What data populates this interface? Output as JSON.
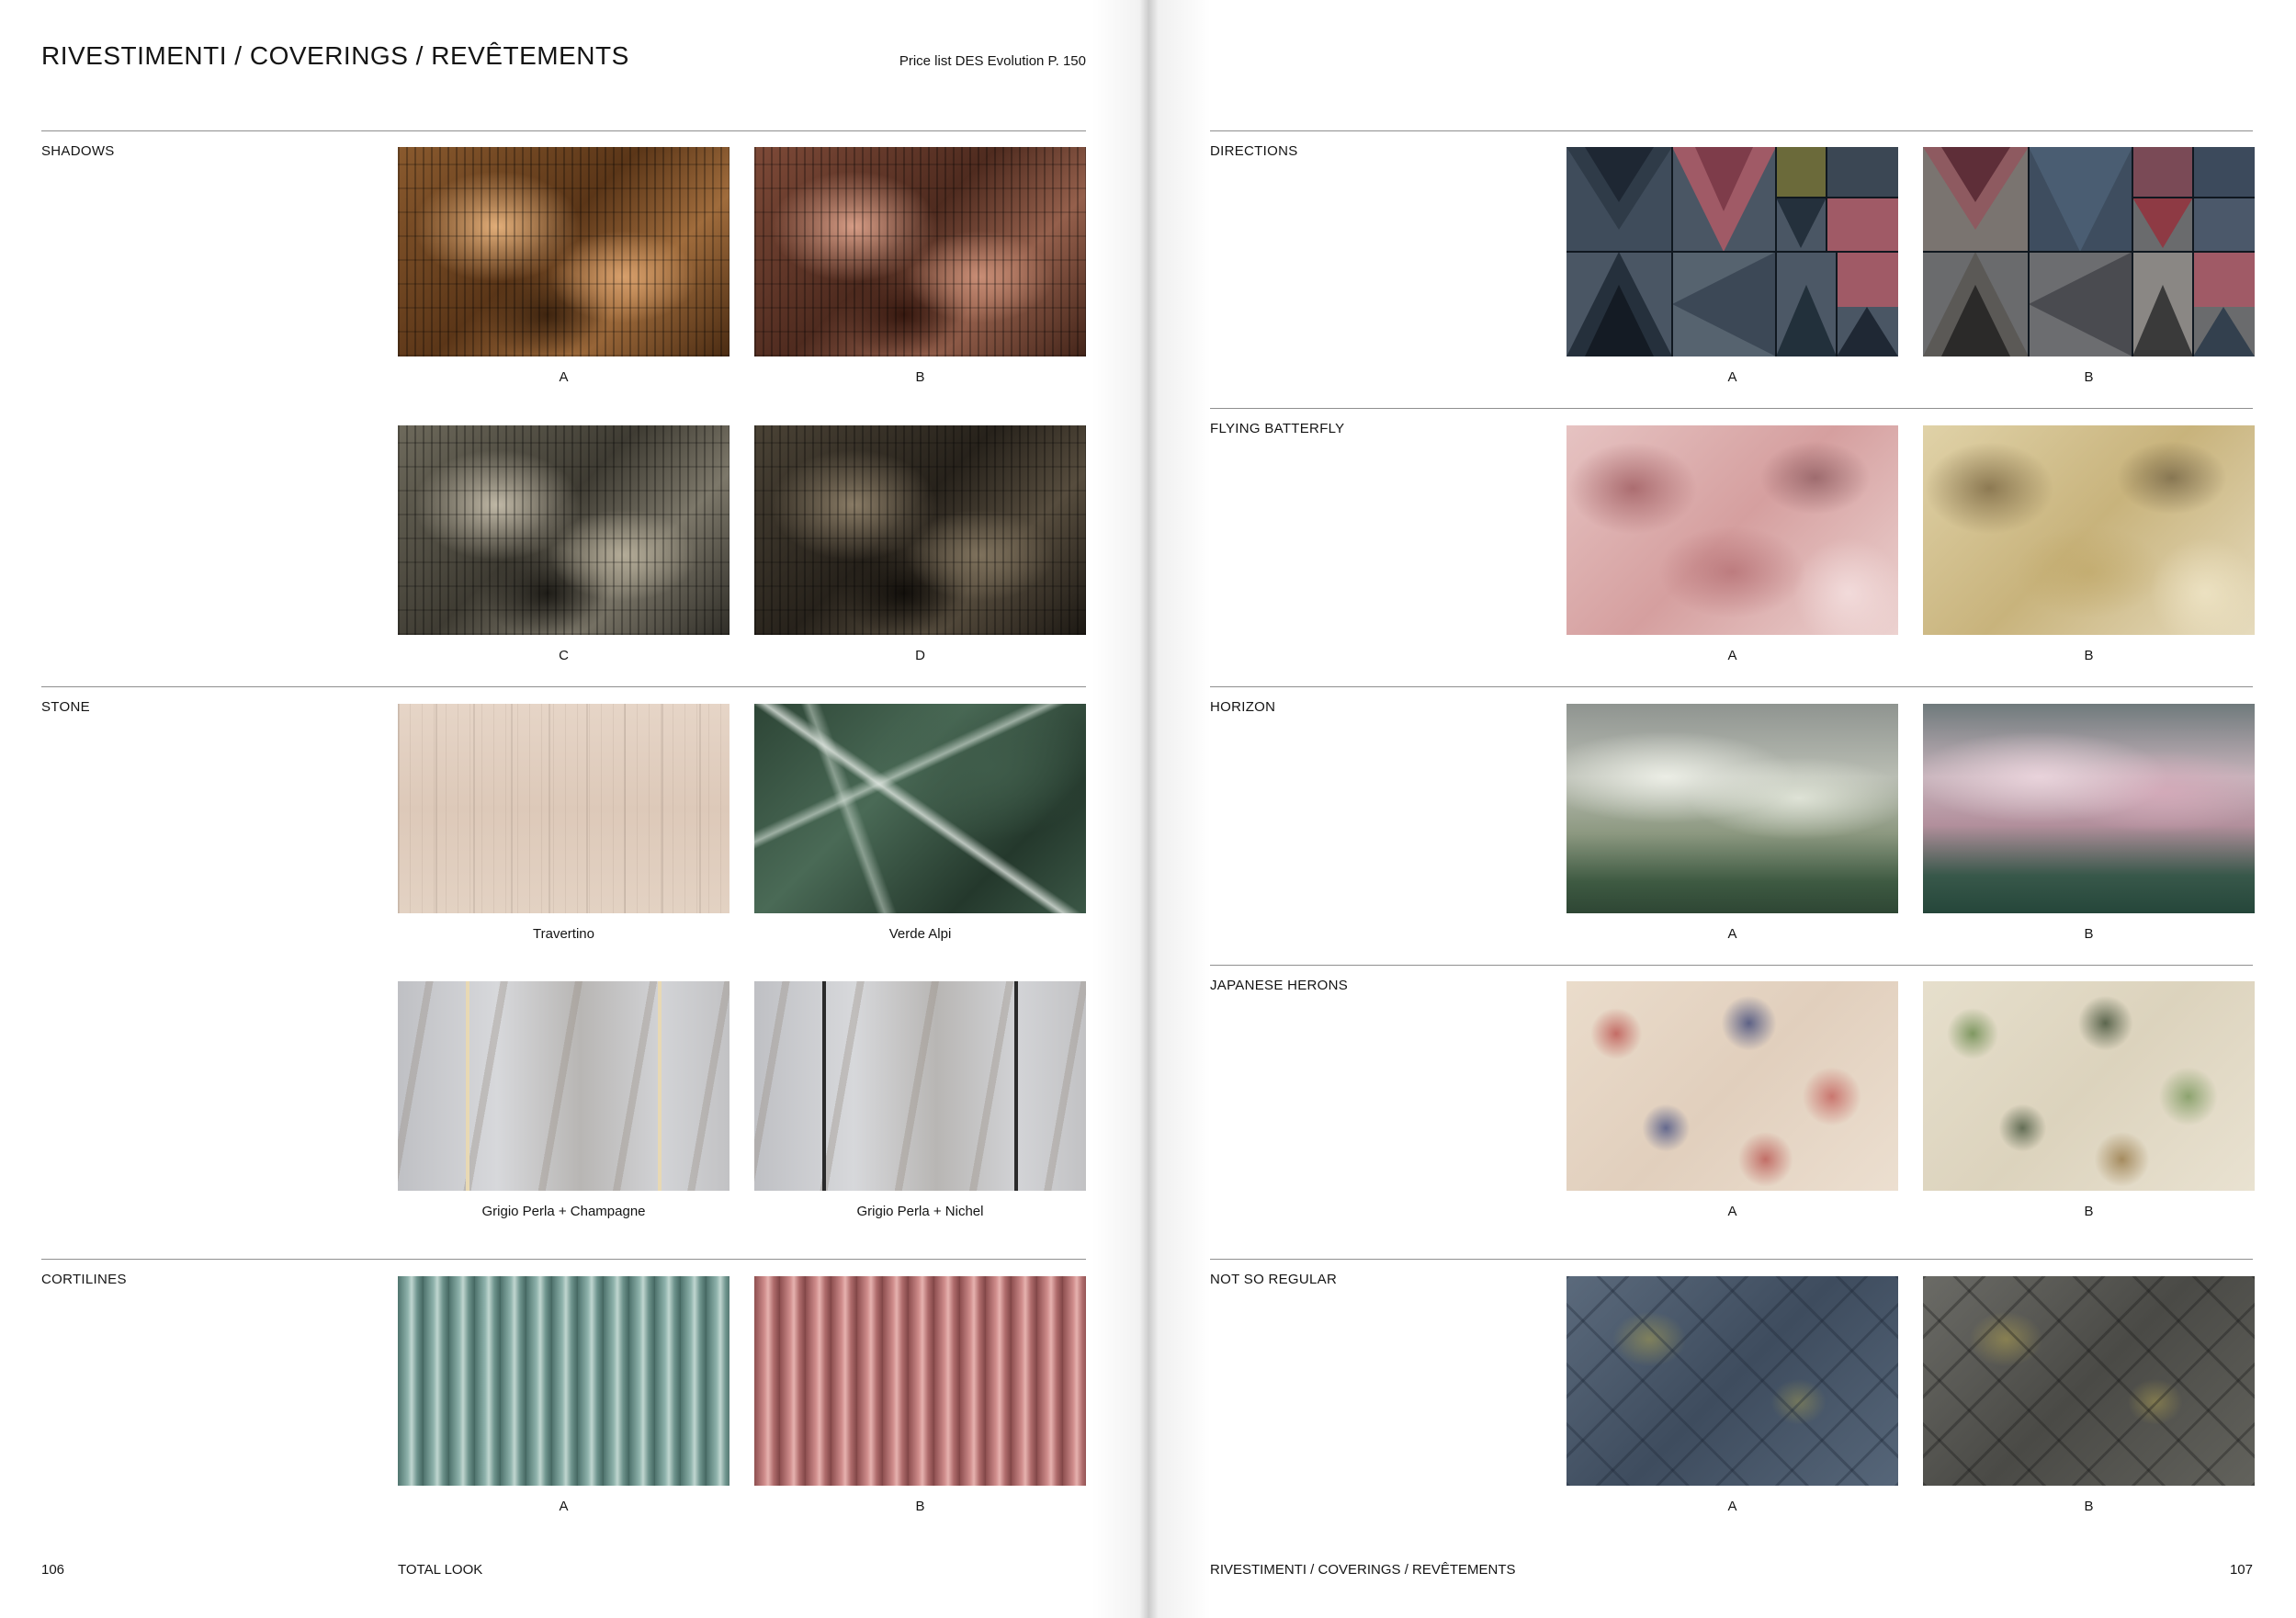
{
  "left_page": {
    "title": "RIVESTIMENTI / COVERINGS / REVÊTEMENTS",
    "price_ref": "Price list DES Evolution P. 150",
    "sections": {
      "shadows": {
        "label": "SHADOWS",
        "captions": [
          "A",
          "B",
          "C",
          "D"
        ]
      },
      "stone": {
        "label": "STONE",
        "captions": [
          "Travertino",
          "Verde Alpi",
          "Grigio Perla + Champagne",
          "Grigio Perla + Nichel"
        ]
      },
      "cortilines": {
        "label": "CORTILINES",
        "captions": [
          "A",
          "B"
        ]
      }
    },
    "footer": {
      "page_number": "106",
      "section": "TOTAL LOOK"
    }
  },
  "right_page": {
    "sections": {
      "directions": {
        "label": "DIRECTIONS",
        "captions": [
          "A",
          "B"
        ]
      },
      "flying_batterfly": {
        "label": "FLYING BATTERFLY",
        "captions": [
          "A",
          "B"
        ]
      },
      "horizon": {
        "label": "HORIZON",
        "captions": [
          "A",
          "B"
        ]
      },
      "japanese_herons": {
        "label": "JAPANESE HERONS",
        "captions": [
          "A",
          "B"
        ]
      },
      "not_so_regular": {
        "label": "NOT SO REGULAR",
        "captions": [
          "A",
          "B"
        ]
      }
    },
    "footer": {
      "section": "RIVESTIMENTI / COVERINGS / REVÊTEMENTS",
      "page_number": "107"
    }
  },
  "colors": {
    "text": "#141414",
    "rule": "#8f8f8f",
    "background": "#ffffff"
  }
}
